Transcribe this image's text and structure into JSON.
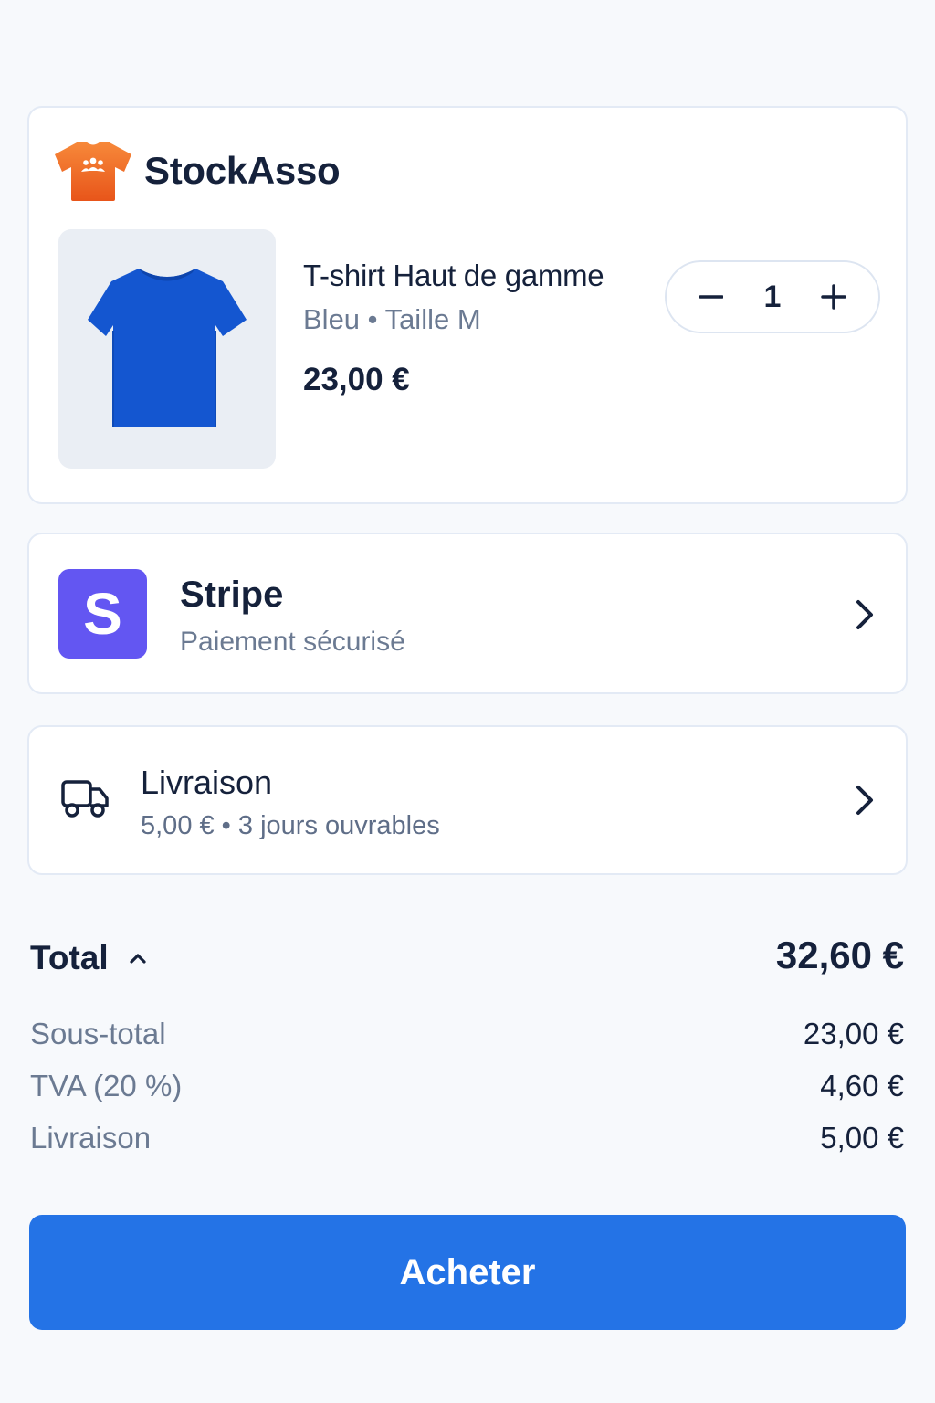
{
  "brand": {
    "name": "StockAsso",
    "logo_icon": "tshirt-people-icon",
    "logo_color": "#f26a21"
  },
  "product": {
    "name": "T-shirt Haut de gamme",
    "variant": "Bleu • Taille M",
    "price": "23,00 €",
    "image_icon": "blue-tshirt-image",
    "image_color": "#1456d0",
    "quantity": "1"
  },
  "payment": {
    "logo_letter": "S",
    "logo_color": "#6356f2",
    "title": "Stripe",
    "subtitle": "Paiement sécurisé"
  },
  "delivery": {
    "icon": "truck-icon",
    "title": "Livraison",
    "subtitle": "5,00 € • 3 jours ouvrables"
  },
  "summary": {
    "total_label": "Total",
    "total_value": "32,60 €",
    "rows": [
      {
        "label": "Sous-total",
        "value": "23,00 €"
      },
      {
        "label": "TVA (20 %)",
        "value": "4,60 €"
      },
      {
        "label": "Livraison",
        "value": "5,00 €"
      }
    ]
  },
  "cta": {
    "label": "Acheter",
    "color": "#2473e6"
  }
}
